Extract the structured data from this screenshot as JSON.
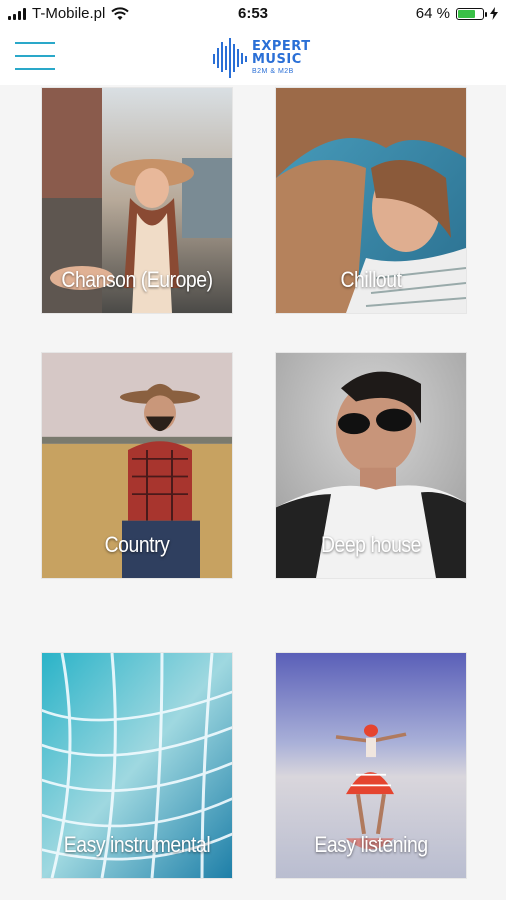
{
  "status_bar": {
    "carrier": "T-Mobile.pl",
    "time": "6:53",
    "battery_percent": "64 %",
    "battery_level": 0.64
  },
  "header": {
    "logo_line1": "EXPERT",
    "logo_line2": "MUSIC",
    "logo_line3": "B2M & M2B"
  },
  "genres": [
    {
      "label": "Chanson (Europe)"
    },
    {
      "label": "Chillout"
    },
    {
      "label": "Country"
    },
    {
      "label": "Deep house"
    },
    {
      "label": "Easy instrumental"
    },
    {
      "label": "Easy listening"
    }
  ]
}
